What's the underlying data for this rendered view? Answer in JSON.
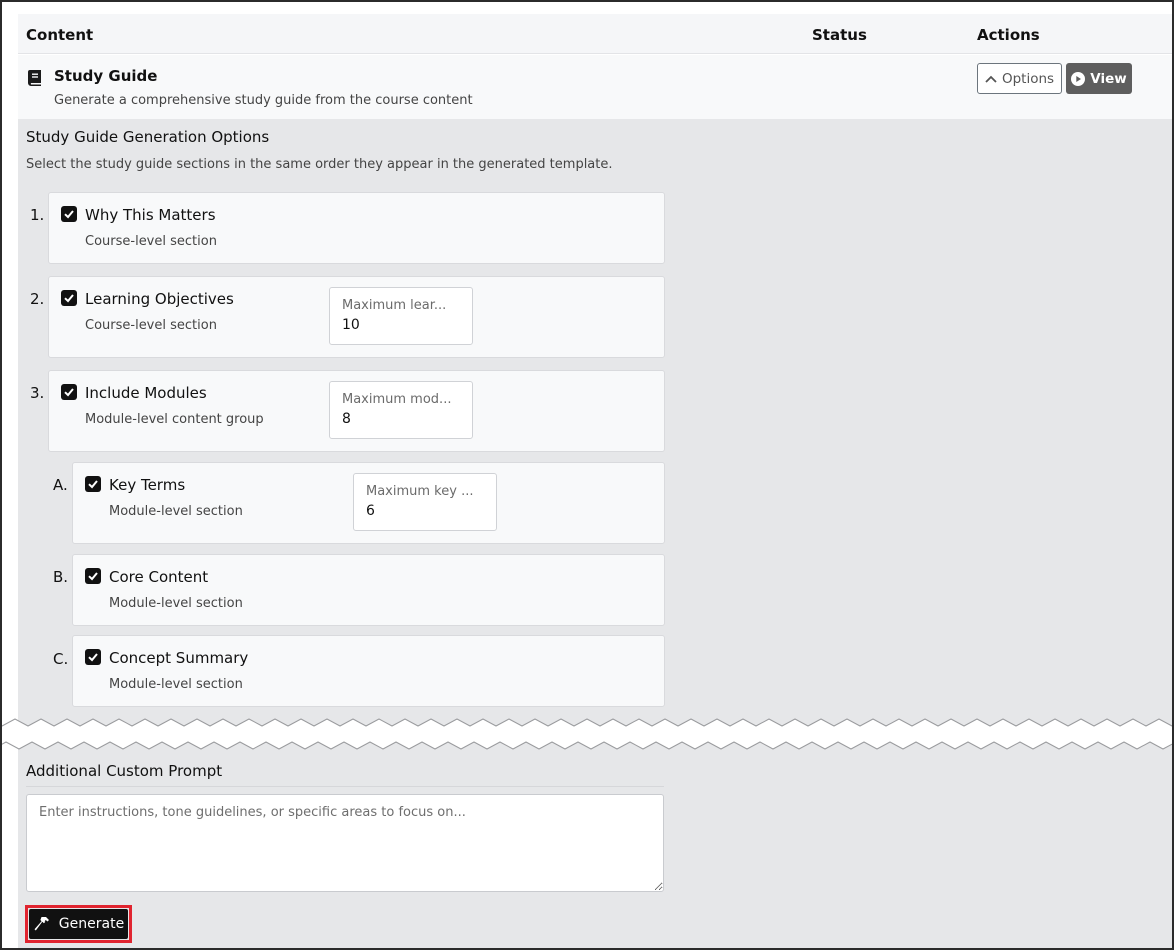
{
  "table": {
    "headers": {
      "content": "Content",
      "status": "Status",
      "actions": "Actions"
    }
  },
  "row": {
    "icon": "book-icon",
    "title": "Study Guide",
    "subtitle": "Generate a comprehensive study guide from the course content",
    "options_label": "Options",
    "view_label": "View"
  },
  "options": {
    "title": "Study Guide Generation Options",
    "description": "Select the study guide sections in the same order they appear in the generated template.",
    "sections": [
      {
        "index": "1.",
        "title": "Why This Matters",
        "subtitle": "Course-level section",
        "checked": true
      },
      {
        "index": "2.",
        "title": "Learning Objectives",
        "subtitle": "Course-level section",
        "checked": true,
        "field_label": "Maximum lear...",
        "field_value": "10"
      },
      {
        "index": "3.",
        "title": "Include Modules",
        "subtitle": "Module-level content group",
        "checked": true,
        "field_label": "Maximum mod...",
        "field_value": "8"
      }
    ],
    "subsections": [
      {
        "index": "A.",
        "title": "Key Terms",
        "subtitle": "Module-level section",
        "checked": true,
        "field_label": "Maximum key ...",
        "field_value": "6"
      },
      {
        "index": "B.",
        "title": "Core Content",
        "subtitle": "Module-level section",
        "checked": true
      },
      {
        "index": "C.",
        "title": "Concept Summary",
        "subtitle": "Module-level section",
        "checked": true
      }
    ]
  },
  "prompt": {
    "label": "Additional Custom Prompt",
    "placeholder": "Enter instructions, tone guidelines, or specific areas to focus on..."
  },
  "generate": {
    "label": "Generate",
    "icon": "hammer-icon",
    "highlight_color": "#e0242f"
  },
  "colors": {
    "panel_bg": "#e6e7e9",
    "card_bg": "#f8f9fa",
    "view_button": "#5e5e5e",
    "generate_button": "#111111"
  }
}
